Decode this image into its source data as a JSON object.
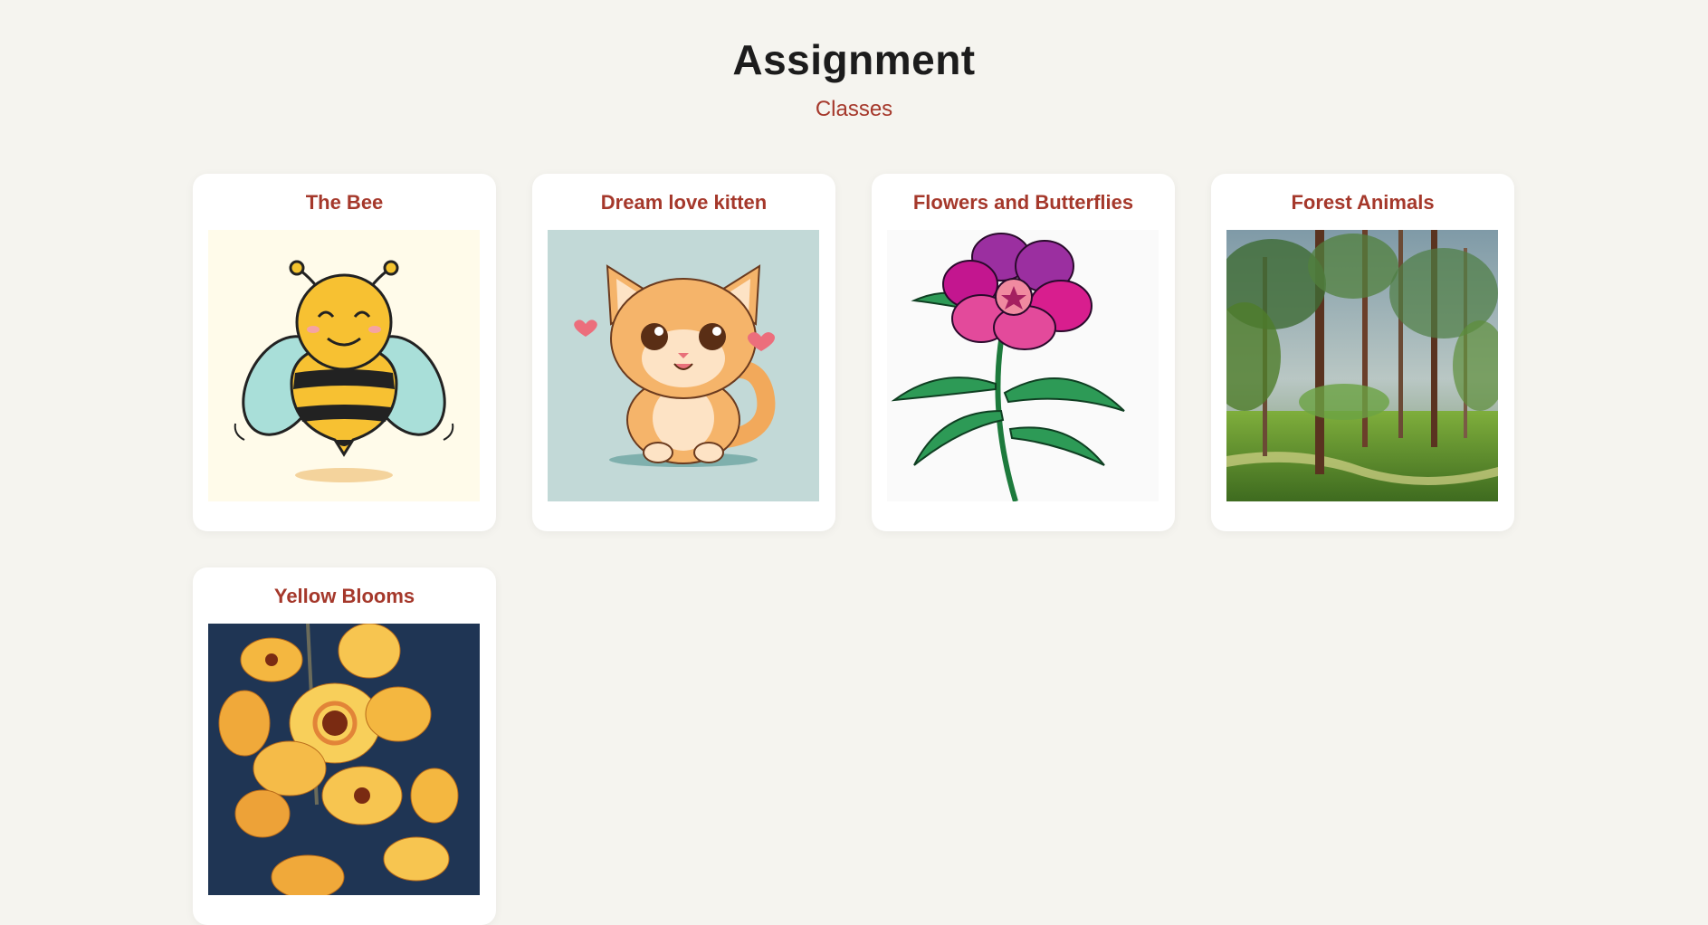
{
  "header": {
    "title": "Assignment",
    "subtitle": "Classes"
  },
  "classes": [
    {
      "title": "The Bee",
      "image": "bee-illustration",
      "bg": "#fffbea"
    },
    {
      "title": "Dream love kitten",
      "image": "kitten-illustration",
      "bg": "#c2d9d7"
    },
    {
      "title": "Flowers and Butterflies",
      "image": "flower-illustration",
      "bg": "#fafafa"
    },
    {
      "title": "Forest Animals",
      "image": "forest-painting",
      "bg": "#8aa6a8"
    },
    {
      "title": "Yellow Blooms",
      "image": "yellow-flowers-painting",
      "bg": "#1f3554"
    }
  ],
  "colors": {
    "accent": "#a5382b",
    "background": "#f5f4ef",
    "title": "#1c1c1c"
  }
}
